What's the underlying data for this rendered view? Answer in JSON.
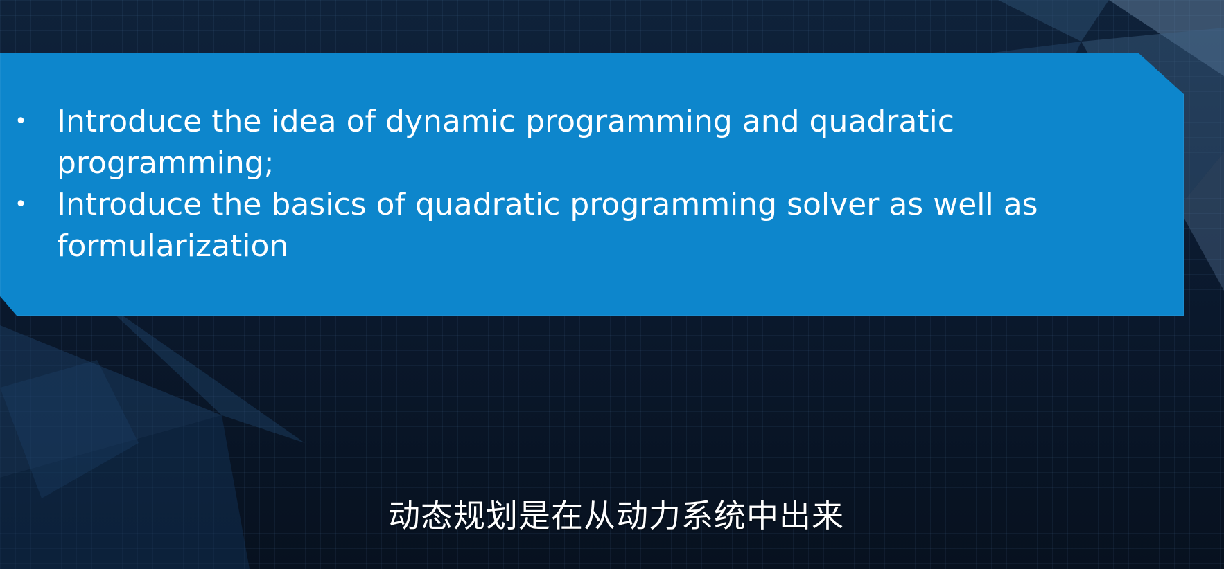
{
  "slide": {
    "bullets": [
      "Introduce the idea of dynamic programming and quadratic programming;",
      "Introduce the basics of quadratic programming solver as well as formularization"
    ],
    "bullet_symbol": "•"
  },
  "subtitle": {
    "text": "动态规划是在从动力系统中出来"
  },
  "colors": {
    "panel": "#0d86cc",
    "background": "#0b1a2f",
    "text": "#ffffff"
  }
}
